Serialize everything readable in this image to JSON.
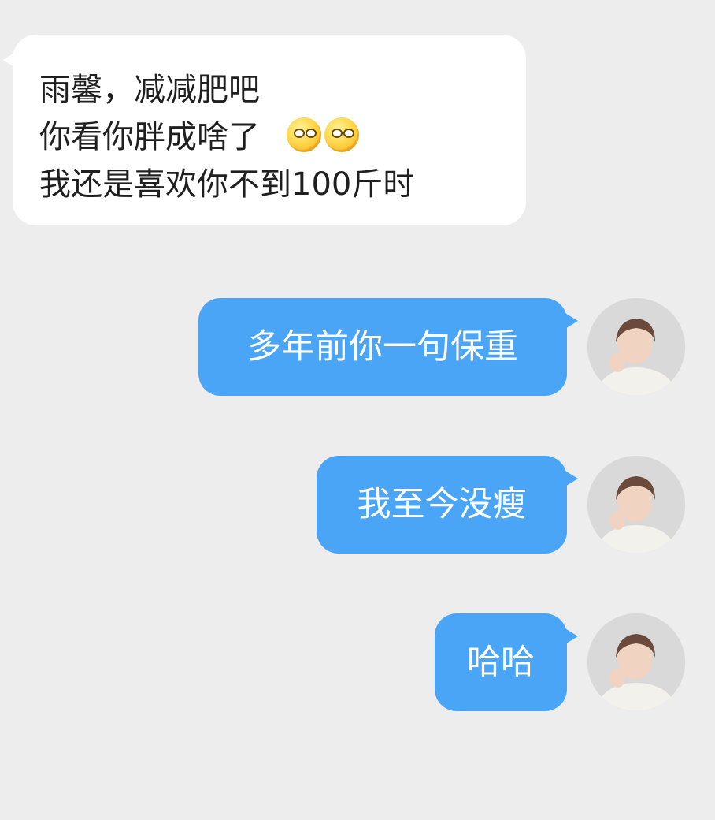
{
  "incoming": {
    "lines": [
      "雨馨，减减肥吧",
      "你看你胖成啥了",
      "我还是喜欢你不到100斤时"
    ],
    "emojis": [
      "thinking-face-icon",
      "thinking-face-icon"
    ]
  },
  "outgoing": [
    {
      "text": "多年前你一句保重"
    },
    {
      "text": "我至今没瘦"
    },
    {
      "text": "哈哈"
    }
  ],
  "colors": {
    "background": "#ededed",
    "incoming_bubble": "#ffffff",
    "outgoing_bubble": "#4aa5f7",
    "outgoing_text": "#ffffff"
  }
}
